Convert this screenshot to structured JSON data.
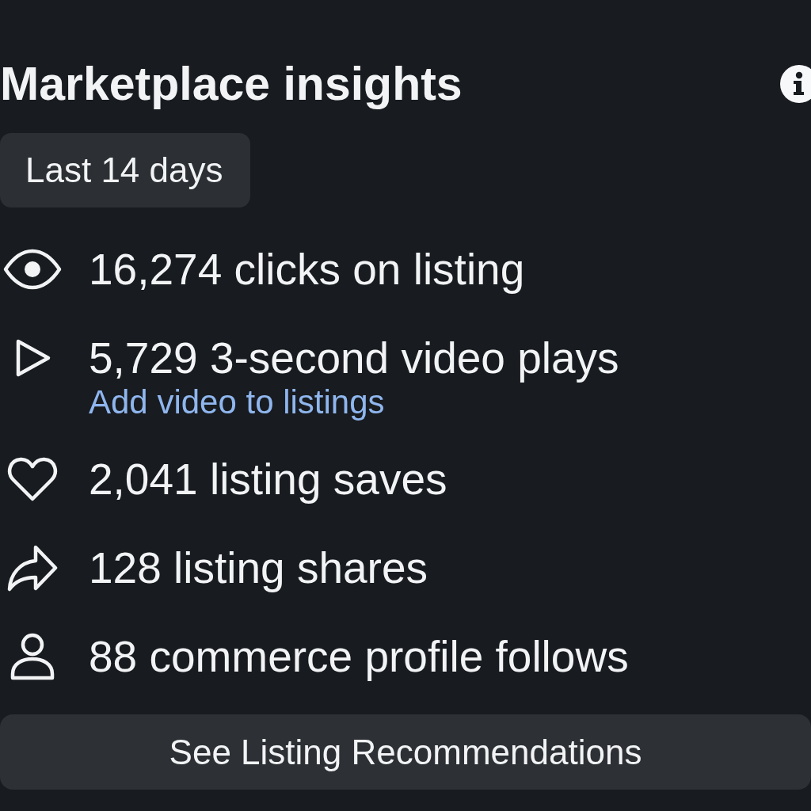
{
  "header": {
    "title": "Marketplace insights"
  },
  "date_range": {
    "label": "Last 14 days"
  },
  "metrics": [
    {
      "text": "16,274 clicks on listing"
    },
    {
      "text": "5,729 3-second video plays",
      "link": "Add video to listings"
    },
    {
      "text": "2,041 listing saves"
    },
    {
      "text": "128 listing shares"
    },
    {
      "text": "88 commerce profile follows"
    }
  ],
  "action_button": {
    "label": "See Listing Recommendations"
  }
}
